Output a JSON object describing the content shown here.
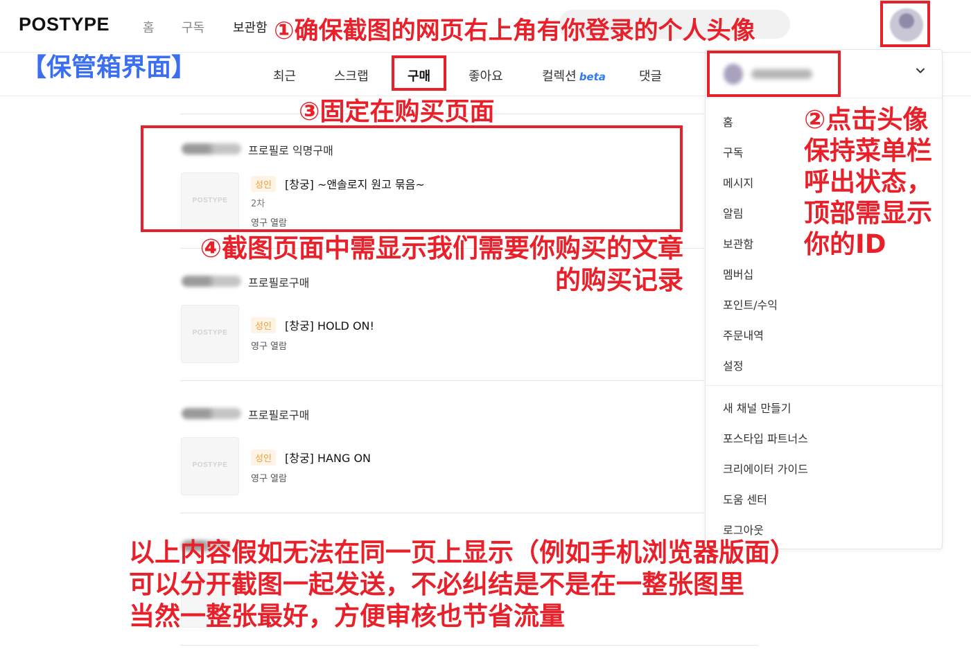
{
  "header": {
    "logo": "POSTYPE",
    "nav": [
      "홈",
      "구독",
      "보관함"
    ]
  },
  "tabs": [
    {
      "label": "최근",
      "beta": ""
    },
    {
      "label": "스크랩",
      "beta": ""
    },
    {
      "label": "구매",
      "beta": ""
    },
    {
      "label": "좋아요",
      "beta": ""
    },
    {
      "label": "컬렉션",
      "beta": "beta"
    },
    {
      "label": "댓글",
      "beta": ""
    }
  ],
  "purchases": [
    {
      "type": "프로필로 익명구매",
      "thumb": "POSTYPE",
      "badge": "성인",
      "title": "[창궁] ~앤솔로지 원고 묶음~",
      "sub": "2차",
      "meta": "영구 열람"
    },
    {
      "type": "프로필로구매",
      "thumb": "POSTYPE",
      "badge": "성인",
      "title": "[창궁] HOLD ON!",
      "sub": "",
      "meta": "영구 열람"
    },
    {
      "type": "프로필로구매",
      "thumb": "POSTYPE",
      "badge": "성인",
      "title": "[창궁] HANG ON",
      "sub": "",
      "meta": "영구 열람"
    }
  ],
  "dropdown": {
    "chevron": "⌄",
    "menu": [
      "홈",
      "구독",
      "메시지",
      "알림",
      "보관함",
      "멤버십",
      "포인트/수익",
      "주문내역",
      "설정"
    ],
    "menu2": [
      "새 채널 만들기",
      "포스타입 파트너스",
      "크리에이터 가이드",
      "도움 센터",
      "로그아웃"
    ]
  },
  "annotations": {
    "step1": "①确保截图的网页右上角有你登录的个人头像",
    "section": "【保管箱界面】",
    "step3": "③固定在购买页面",
    "step2": [
      "②点击头像",
      "保持菜单栏",
      "呼出状态，",
      "顶部需显示",
      "你的ID"
    ],
    "step4": [
      "④截图页面中需显示我们需要你购买的文章",
      "的购买记录"
    ],
    "footer": [
      "以上内容假如无法在同一页上显示（例如手机浏览器版面）",
      "可以分开截图一起发送，不必纠结是不是在一整张图里",
      "当然一整张最好，方便审核也节省流量"
    ]
  }
}
